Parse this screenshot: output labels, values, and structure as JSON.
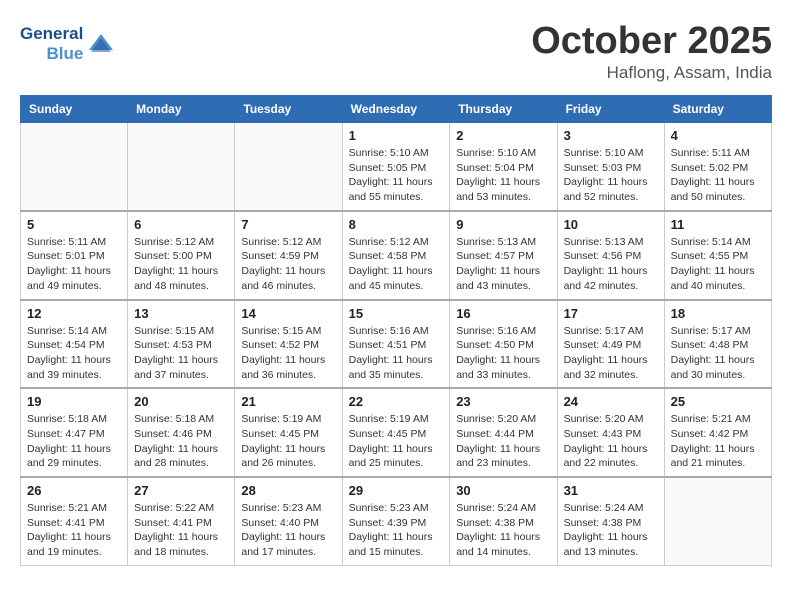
{
  "logo": {
    "line1": "General",
    "line2": "Blue"
  },
  "title": "October 2025",
  "location": "Haflong, Assam, India",
  "weekdays": [
    "Sunday",
    "Monday",
    "Tuesday",
    "Wednesday",
    "Thursday",
    "Friday",
    "Saturday"
  ],
  "weeks": [
    [
      {
        "day": "",
        "sunrise": "",
        "sunset": "",
        "daylight": ""
      },
      {
        "day": "",
        "sunrise": "",
        "sunset": "",
        "daylight": ""
      },
      {
        "day": "",
        "sunrise": "",
        "sunset": "",
        "daylight": ""
      },
      {
        "day": "1",
        "sunrise": "Sunrise: 5:10 AM",
        "sunset": "Sunset: 5:05 PM",
        "daylight": "Daylight: 11 hours and 55 minutes."
      },
      {
        "day": "2",
        "sunrise": "Sunrise: 5:10 AM",
        "sunset": "Sunset: 5:04 PM",
        "daylight": "Daylight: 11 hours and 53 minutes."
      },
      {
        "day": "3",
        "sunrise": "Sunrise: 5:10 AM",
        "sunset": "Sunset: 5:03 PM",
        "daylight": "Daylight: 11 hours and 52 minutes."
      },
      {
        "day": "4",
        "sunrise": "Sunrise: 5:11 AM",
        "sunset": "Sunset: 5:02 PM",
        "daylight": "Daylight: 11 hours and 50 minutes."
      }
    ],
    [
      {
        "day": "5",
        "sunrise": "Sunrise: 5:11 AM",
        "sunset": "Sunset: 5:01 PM",
        "daylight": "Daylight: 11 hours and 49 minutes."
      },
      {
        "day": "6",
        "sunrise": "Sunrise: 5:12 AM",
        "sunset": "Sunset: 5:00 PM",
        "daylight": "Daylight: 11 hours and 48 minutes."
      },
      {
        "day": "7",
        "sunrise": "Sunrise: 5:12 AM",
        "sunset": "Sunset: 4:59 PM",
        "daylight": "Daylight: 11 hours and 46 minutes."
      },
      {
        "day": "8",
        "sunrise": "Sunrise: 5:12 AM",
        "sunset": "Sunset: 4:58 PM",
        "daylight": "Daylight: 11 hours and 45 minutes."
      },
      {
        "day": "9",
        "sunrise": "Sunrise: 5:13 AM",
        "sunset": "Sunset: 4:57 PM",
        "daylight": "Daylight: 11 hours and 43 minutes."
      },
      {
        "day": "10",
        "sunrise": "Sunrise: 5:13 AM",
        "sunset": "Sunset: 4:56 PM",
        "daylight": "Daylight: 11 hours and 42 minutes."
      },
      {
        "day": "11",
        "sunrise": "Sunrise: 5:14 AM",
        "sunset": "Sunset: 4:55 PM",
        "daylight": "Daylight: 11 hours and 40 minutes."
      }
    ],
    [
      {
        "day": "12",
        "sunrise": "Sunrise: 5:14 AM",
        "sunset": "Sunset: 4:54 PM",
        "daylight": "Daylight: 11 hours and 39 minutes."
      },
      {
        "day": "13",
        "sunrise": "Sunrise: 5:15 AM",
        "sunset": "Sunset: 4:53 PM",
        "daylight": "Daylight: 11 hours and 37 minutes."
      },
      {
        "day": "14",
        "sunrise": "Sunrise: 5:15 AM",
        "sunset": "Sunset: 4:52 PM",
        "daylight": "Daylight: 11 hours and 36 minutes."
      },
      {
        "day": "15",
        "sunrise": "Sunrise: 5:16 AM",
        "sunset": "Sunset: 4:51 PM",
        "daylight": "Daylight: 11 hours and 35 minutes."
      },
      {
        "day": "16",
        "sunrise": "Sunrise: 5:16 AM",
        "sunset": "Sunset: 4:50 PM",
        "daylight": "Daylight: 11 hours and 33 minutes."
      },
      {
        "day": "17",
        "sunrise": "Sunrise: 5:17 AM",
        "sunset": "Sunset: 4:49 PM",
        "daylight": "Daylight: 11 hours and 32 minutes."
      },
      {
        "day": "18",
        "sunrise": "Sunrise: 5:17 AM",
        "sunset": "Sunset: 4:48 PM",
        "daylight": "Daylight: 11 hours and 30 minutes."
      }
    ],
    [
      {
        "day": "19",
        "sunrise": "Sunrise: 5:18 AM",
        "sunset": "Sunset: 4:47 PM",
        "daylight": "Daylight: 11 hours and 29 minutes."
      },
      {
        "day": "20",
        "sunrise": "Sunrise: 5:18 AM",
        "sunset": "Sunset: 4:46 PM",
        "daylight": "Daylight: 11 hours and 28 minutes."
      },
      {
        "day": "21",
        "sunrise": "Sunrise: 5:19 AM",
        "sunset": "Sunset: 4:45 PM",
        "daylight": "Daylight: 11 hours and 26 minutes."
      },
      {
        "day": "22",
        "sunrise": "Sunrise: 5:19 AM",
        "sunset": "Sunset: 4:45 PM",
        "daylight": "Daylight: 11 hours and 25 minutes."
      },
      {
        "day": "23",
        "sunrise": "Sunrise: 5:20 AM",
        "sunset": "Sunset: 4:44 PM",
        "daylight": "Daylight: 11 hours and 23 minutes."
      },
      {
        "day": "24",
        "sunrise": "Sunrise: 5:20 AM",
        "sunset": "Sunset: 4:43 PM",
        "daylight": "Daylight: 11 hours and 22 minutes."
      },
      {
        "day": "25",
        "sunrise": "Sunrise: 5:21 AM",
        "sunset": "Sunset: 4:42 PM",
        "daylight": "Daylight: 11 hours and 21 minutes."
      }
    ],
    [
      {
        "day": "26",
        "sunrise": "Sunrise: 5:21 AM",
        "sunset": "Sunset: 4:41 PM",
        "daylight": "Daylight: 11 hours and 19 minutes."
      },
      {
        "day": "27",
        "sunrise": "Sunrise: 5:22 AM",
        "sunset": "Sunset: 4:41 PM",
        "daylight": "Daylight: 11 hours and 18 minutes."
      },
      {
        "day": "28",
        "sunrise": "Sunrise: 5:23 AM",
        "sunset": "Sunset: 4:40 PM",
        "daylight": "Daylight: 11 hours and 17 minutes."
      },
      {
        "day": "29",
        "sunrise": "Sunrise: 5:23 AM",
        "sunset": "Sunset: 4:39 PM",
        "daylight": "Daylight: 11 hours and 15 minutes."
      },
      {
        "day": "30",
        "sunrise": "Sunrise: 5:24 AM",
        "sunset": "Sunset: 4:38 PM",
        "daylight": "Daylight: 11 hours and 14 minutes."
      },
      {
        "day": "31",
        "sunrise": "Sunrise: 5:24 AM",
        "sunset": "Sunset: 4:38 PM",
        "daylight": "Daylight: 11 hours and 13 minutes."
      },
      {
        "day": "",
        "sunrise": "",
        "sunset": "",
        "daylight": ""
      }
    ]
  ]
}
